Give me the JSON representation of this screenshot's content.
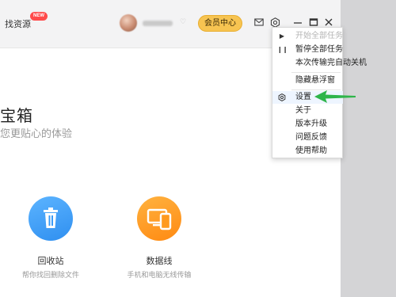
{
  "titlebar": {
    "find_resources": "找资源",
    "new_badge": "NEW",
    "vip_button": "会员中心",
    "icons": [
      "mail-icon",
      "gear-icon",
      "minimize-icon",
      "maximize-icon",
      "close-icon"
    ]
  },
  "main": {
    "title": "宝箱",
    "subtitle": "您更贴心的体验",
    "tiles": [
      {
        "label": "回收站",
        "sub": "帮你找回删除文件",
        "icon": "trash-icon",
        "color": "#3a9bf7"
      },
      {
        "label": "数据线",
        "sub": "手机和电脑无线传输",
        "icon": "devices-icon",
        "color": "#ff9a1f"
      }
    ]
  },
  "menu": {
    "items": [
      {
        "label": "开始全部任务",
        "disabled": true,
        "icon": "play-icon"
      },
      {
        "label": "暂停全部任务",
        "icon": "pause-icon"
      },
      {
        "label": "本次传输完自动关机"
      },
      {
        "label": "隐藏悬浮窗"
      },
      {
        "label": "设置",
        "active": true,
        "icon": "gear-icon"
      },
      {
        "label": "关于"
      },
      {
        "label": "版本升级"
      },
      {
        "label": "问题反馈"
      },
      {
        "label": "使用帮助"
      }
    ]
  },
  "colors": {
    "vip": "#f7c451",
    "badge": "#ff4a4a",
    "arrow": "#2fb54a",
    "strip": "#d4d4d6"
  }
}
